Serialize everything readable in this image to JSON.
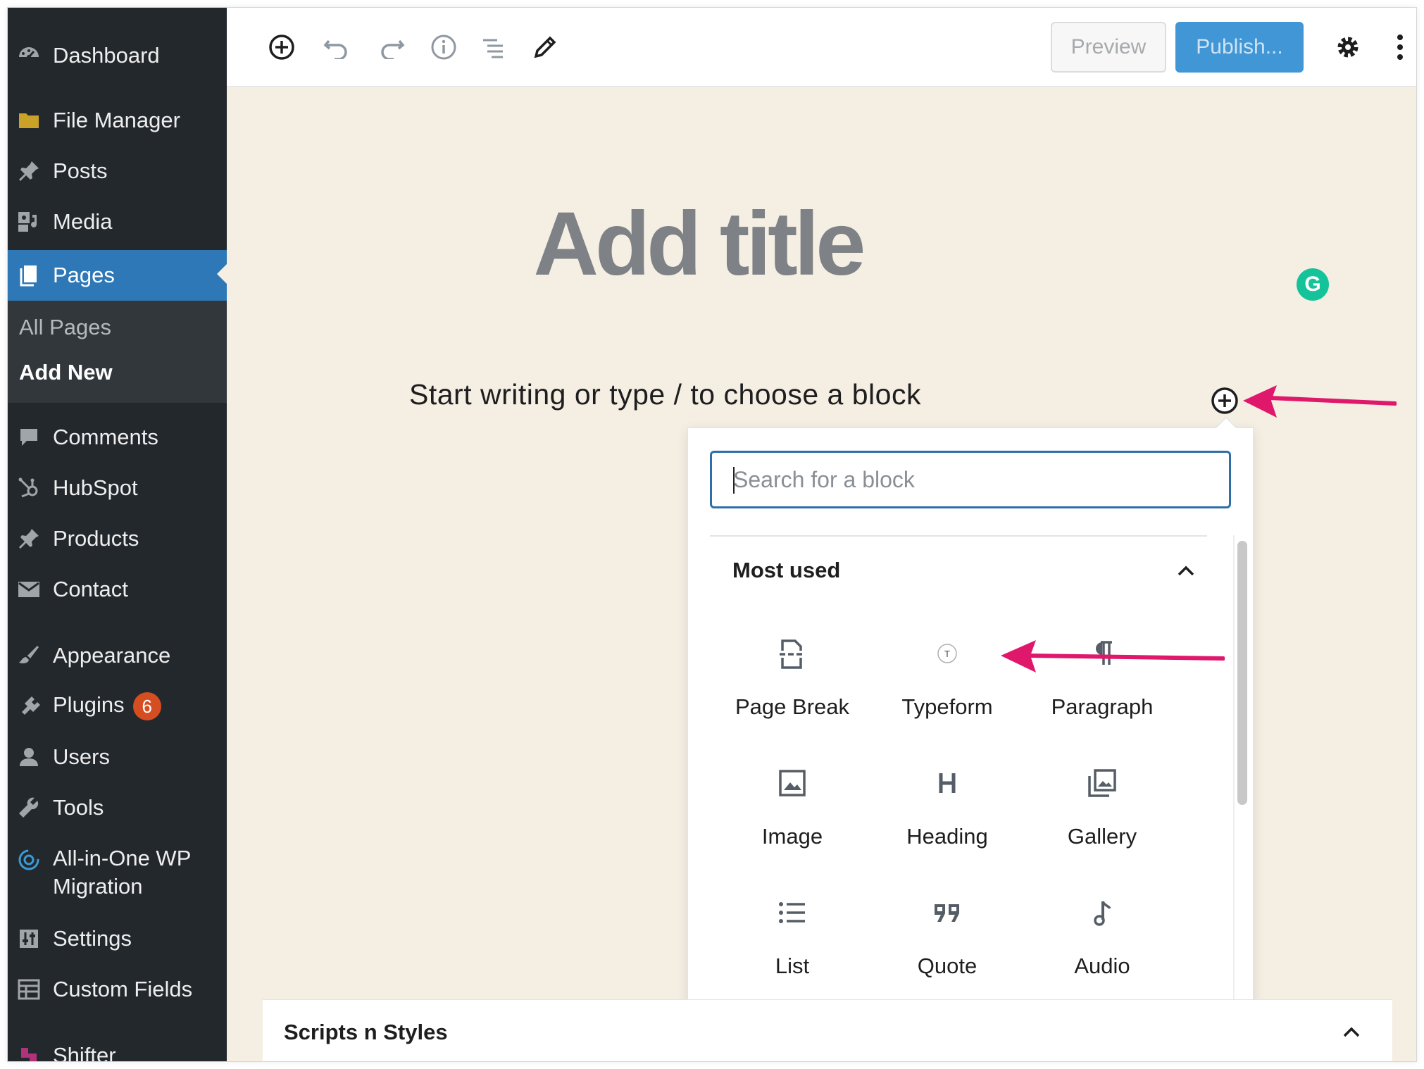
{
  "sidebar": {
    "items": [
      {
        "id": "dashboard",
        "label": "Dashboard",
        "icon": "dashboard-icon"
      },
      {
        "id": "file-manager",
        "label": "File Manager",
        "icon": "folder-icon"
      },
      {
        "id": "posts",
        "label": "Posts",
        "icon": "pushpin-icon"
      },
      {
        "id": "media",
        "label": "Media",
        "icon": "media-icon"
      },
      {
        "id": "pages",
        "label": "Pages",
        "icon": "pages-icon"
      },
      {
        "id": "comments",
        "label": "Comments",
        "icon": "comment-icon"
      },
      {
        "id": "hubspot",
        "label": "HubSpot",
        "icon": "hubspot-icon"
      },
      {
        "id": "products",
        "label": "Products",
        "icon": "pushpin-icon"
      },
      {
        "id": "contact",
        "label": "Contact",
        "icon": "envelope-icon"
      },
      {
        "id": "appearance",
        "label": "Appearance",
        "icon": "paintbrush-icon"
      },
      {
        "id": "plugins",
        "label": "Plugins",
        "icon": "plug-icon",
        "badge": "6"
      },
      {
        "id": "users",
        "label": "Users",
        "icon": "user-icon"
      },
      {
        "id": "tools",
        "label": "Tools",
        "icon": "wrench-icon"
      },
      {
        "id": "all-in-one",
        "label_line1": "All-in-One WP",
        "label_line2": "Migration",
        "icon": "migration-icon"
      },
      {
        "id": "settings",
        "label": "Settings",
        "icon": "settings-sliders-icon"
      },
      {
        "id": "custom-fields",
        "label": "Custom Fields",
        "icon": "table-icon"
      },
      {
        "id": "shifter",
        "label": "Shifter",
        "icon": "shifter-icon"
      }
    ],
    "active": "pages",
    "submenu": {
      "all_pages": "All Pages",
      "add_new": "Add New"
    }
  },
  "toolbar": {
    "preview_label": "Preview",
    "publish_label": "Publish..."
  },
  "editor": {
    "title_placeholder": "Add title",
    "body_placeholder": "Start writing or type / to choose a block",
    "grammarly_letter": "G"
  },
  "inserter": {
    "search_placeholder": "Search for a block",
    "section_title": "Most used",
    "blocks": [
      {
        "label": "Page Break",
        "icon": "page-break-icon"
      },
      {
        "label": "Typeform",
        "icon": "typeform-icon"
      },
      {
        "label": "Paragraph",
        "icon": "paragraph-icon"
      },
      {
        "label": "Image",
        "icon": "image-icon"
      },
      {
        "label": "Heading",
        "icon": "heading-icon"
      },
      {
        "label": "Gallery",
        "icon": "gallery-icon"
      },
      {
        "label": "List",
        "icon": "list-icon"
      },
      {
        "label": "Quote",
        "icon": "quote-icon"
      },
      {
        "label": "Audio",
        "icon": "audio-icon"
      }
    ]
  },
  "metabox": {
    "title": "Scripts n Styles"
  },
  "colors": {
    "sidebar_bg": "#23282d",
    "active_menu": "#2e78b7",
    "publish_button": "#4196d5",
    "annotation_arrow": "#e0186c",
    "plugin_badge": "#d54e21",
    "grammarly": "#15c39a"
  }
}
